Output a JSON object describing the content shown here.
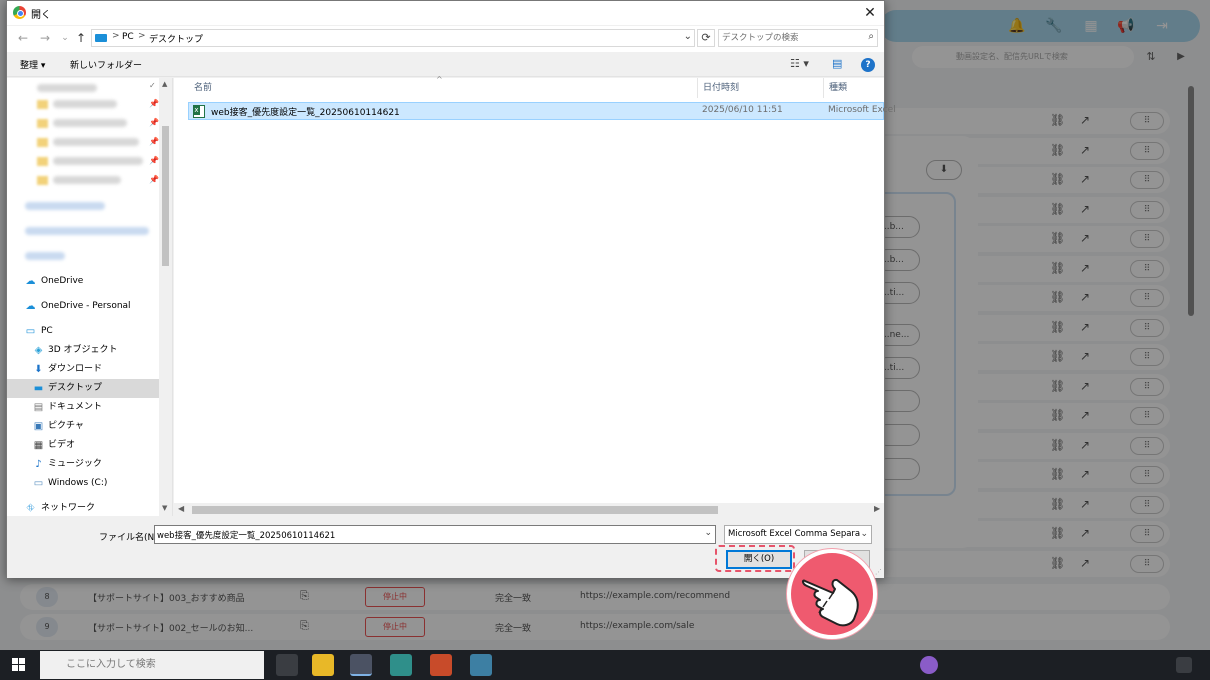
{
  "dialog": {
    "title": "開く",
    "close_label": "✕",
    "nav": {
      "back": "←",
      "forward": "→",
      "recent": "⌄",
      "up": "↑"
    },
    "address": {
      "crumbs": [
        "PC",
        "デスクトップ"
      ],
      "separator": ">"
    },
    "refresh": "⟳",
    "search_placeholder": "デスクトップの検索",
    "toolbar": {
      "organize": "整理 ▾",
      "new_folder": "新しいフォルダー"
    },
    "sidebar": {
      "items": [
        {
          "label": "OneDrive",
          "icon": "onedrive-cloud-icon"
        },
        {
          "label": "OneDrive - Personal",
          "icon": "onedrive-cloud-icon"
        },
        {
          "label": "PC",
          "icon": "pc-icon"
        },
        {
          "label": "3D オブジェクト",
          "icon": "3d-objects-icon"
        },
        {
          "label": "ダウンロード",
          "icon": "download-icon"
        },
        {
          "label": "デスクトップ",
          "icon": "desktop-icon",
          "selected": true
        },
        {
          "label": "ドキュメント",
          "icon": "documents-icon"
        },
        {
          "label": "ピクチャ",
          "icon": "pictures-icon"
        },
        {
          "label": "ビデオ",
          "icon": "videos-icon"
        },
        {
          "label": "ミュージック",
          "icon": "music-icon"
        },
        {
          "label": "Windows (C:)",
          "icon": "drive-icon"
        },
        {
          "label": "ネットワーク",
          "icon": "network-icon"
        }
      ]
    },
    "columns": {
      "name": "名前",
      "date": "日付時刻",
      "type": "種類"
    },
    "files": [
      {
        "name": "web接客_優先度設定一覧_20250610114621",
        "date": "2025/06/10 11:51",
        "type": "Microsoft Excel"
      }
    ],
    "filename_label": "ファイル名(N):",
    "filename_value": "web接客_優先度設定一覧_20250610114621",
    "filetype": "Microsoft Excel Comma Separa",
    "open_button": "開く(O)",
    "cancel_button": ""
  },
  "background": {
    "search_placeholder": "動画設定名、配信先URLで検索",
    "rows": [
      {
        "num": "8",
        "name": "【サポートサイト】003_おすすめ商品",
        "status": "停止中",
        "match": "完全一致",
        "url": "https://example.com/recommend"
      },
      {
        "num": "9",
        "name": "【サポートサイト】002_セールのお知...",
        "status": "停止中",
        "match": "完全一致",
        "url": "https://example.com/sale"
      }
    ],
    "modal_fields": [
      "...b...",
      "...b...",
      "...ti...",
      "...ne...",
      "...ti..."
    ]
  },
  "taskbar": {
    "search_placeholder": "ここに入力して検索"
  },
  "colors": {
    "accent": "#0078d7",
    "highlight": "#e6546a",
    "selection": "#cce8ff",
    "callout": "#ef5a6f"
  }
}
